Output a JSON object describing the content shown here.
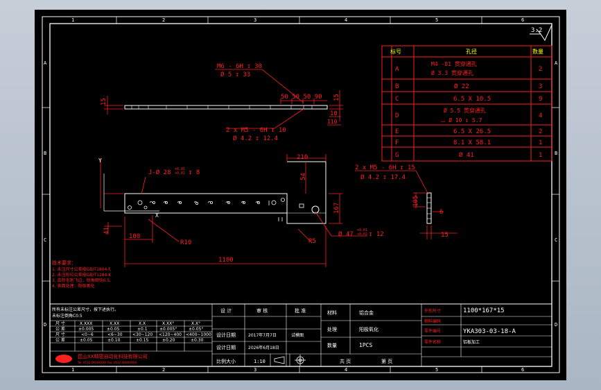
{
  "colors": {
    "background": "#000000",
    "frame": "#ffffff",
    "part": "#ffffff",
    "dimension": "#ff2020",
    "annotation": "#ffff00",
    "table_line": "#ff2020"
  },
  "zones": {
    "columns": [
      "1",
      "2",
      "3",
      "4",
      "5",
      "6"
    ],
    "rows": [
      "A",
      "B",
      "C",
      "D"
    ]
  },
  "roughness": "3.2",
  "hole_table": {
    "headers": [
      "标号",
      "孔径",
      "数量"
    ],
    "rows": [
      {
        "mark": "A",
        "desc": "M4 -81 贯穿通孔",
        "desc2": "Ø 3.3 贯穿通孔",
        "qty": "2"
      },
      {
        "mark": "B",
        "desc": "Ø 22",
        "desc2": "",
        "qty": "3"
      },
      {
        "mark": "C",
        "desc": "6.5 X 10.5",
        "desc2": "",
        "qty": "9"
      },
      {
        "mark": "D",
        "desc": "Ø 5.5 贯穿通孔",
        "desc2": "⌴ Ø 10 ↧ 5.7",
        "qty": "4"
      },
      {
        "mark": "E",
        "desc": "6.5 X 26.5",
        "desc2": "",
        "qty": "2"
      },
      {
        "mark": "F",
        "desc": "8.1 X 58.1",
        "desc2": "",
        "qty": "1"
      },
      {
        "mark": "G",
        "desc": "Ø 41",
        "desc2": "",
        "qty": "1"
      }
    ]
  },
  "dims": {
    "top_thread": "M6 - 6H ↧ 30",
    "top_hole": "Ø 5 ↧ 33",
    "top_spacing": "50 50 50 90",
    "top_height": "15",
    "right_15": "15",
    "right_10": "10",
    "right_110": "110",
    "mid_thread": "2 x M5 - 6H ↧ 10",
    "mid_hole": "Ø 4.2 ↧ 12.4",
    "side_thread": "2 x M5 - 6H ↧ 15",
    "side_hole": "Ø 4.2 ↧ 17.4",
    "hole_spec": "J-Ø 28",
    "tol_plus": "+0.01",
    "tol_minus": "+0.02",
    "hole_depth": "↧ 8",
    "dim_210": "210",
    "dim_54": "54",
    "dim_167": "167",
    "dim_41": "41",
    "dim_100": "100",
    "dim_R10": "R10",
    "dim_R5": "R5",
    "dim_1100": "1100",
    "dim_47": "Ø 47",
    "dim_12": "↧ 12",
    "dim_105": "105",
    "dim_6": "6",
    "dim_15b": "15",
    "axis_y": "Y",
    "axis_x": "X"
  },
  "notes": [
    "技术要求：",
    "1. 未注尺寸公差按GB/T1804-f,",
    "2. 未注形位公差按GB/T1184-K",
    "3. 去除毛刺飞边，锐角倒钝0.5,",
    "4. 表面处理：阳极氧化"
  ],
  "title_block": {
    "note_line1": "所有未标注公差尺寸，按下述执行。",
    "note_line2": "未标注倒角C0.5",
    "tol_header": [
      "尺 寸",
      "X.XXX",
      "X.XX",
      "X.X",
      "X.XX°",
      "X.X°"
    ],
    "tol_rows": [
      [
        "公 差",
        "±0.005",
        "±0.05",
        "±0.1",
        "±0.005°",
        "±0.05°"
      ],
      [
        "尺 寸",
        "<0~6",
        "<6~30",
        "<30~120",
        "<120~400",
        "<400~1000"
      ],
      [
        "公 差",
        "±0.05",
        "±0.10",
        "±0.15",
        "±0.20",
        "±0.30"
      ]
    ],
    "company": "昆山XX精密自动化科技有限公司",
    "company_sub": "Tel: 0512-XXXXXXXX  Fax: 0512-XXXXXXXX",
    "design": "设 计",
    "check": "审 核",
    "approve": "批 准",
    "date_label": "设计日期",
    "date_value": "2017年7月7日",
    "stage": "试模图",
    "draw_label": "设计日期",
    "draw_value": "2026年6月18日",
    "scale_label": "比例大小",
    "scale_value": "1:10",
    "material_label": "材料",
    "material_value": "铝合金",
    "surface_label": "处理",
    "surface_value": "阳极氧化",
    "qty_label": "数量",
    "qty_value": "1PCS",
    "size_label": "外形尺寸",
    "size_value": "1100*167*15",
    "code_label": "物料编码",
    "code_value": "",
    "part_no_label": "零件编号",
    "part_no_value": "YKA303-03-18-A",
    "part_name_label": "零件名称",
    "part_name_value": "铝板加工",
    "sheet": "共 页",
    "sheet2": "第 页"
  }
}
